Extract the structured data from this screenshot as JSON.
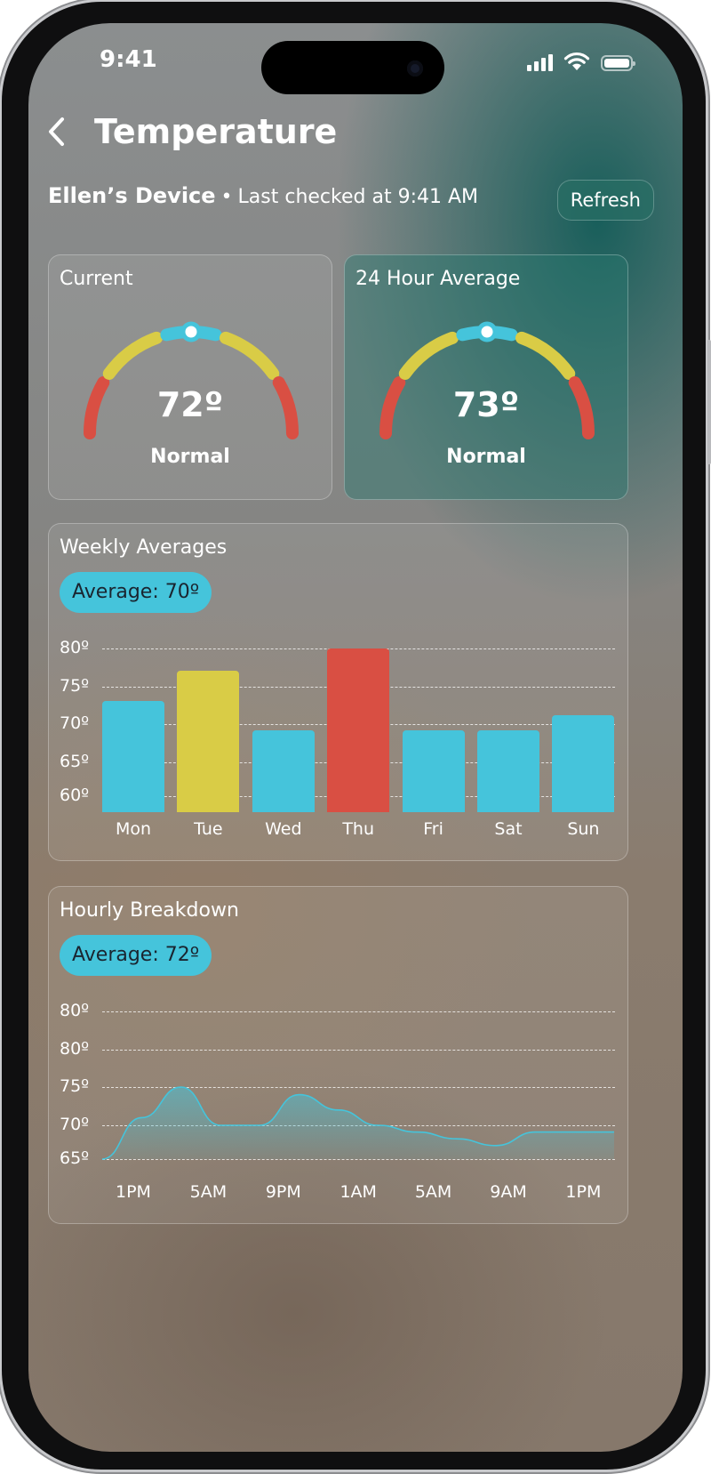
{
  "status_bar": {
    "time": "9:41"
  },
  "header": {
    "title": "Temperature",
    "back_icon": "chevron-left-icon"
  },
  "device": {
    "name": "Ellen’s Device",
    "separator": "•",
    "last_checked": "Last checked at 9:41 AM",
    "refresh_label": "Refresh"
  },
  "gauges": [
    {
      "label": "Current",
      "value": "72º",
      "status": "Normal",
      "level": 0.5
    },
    {
      "label": "24 Hour Average",
      "value": "73º",
      "status": "Normal",
      "level": 0.5
    }
  ],
  "colors": {
    "cool": "#45c4db",
    "warm": "#d9cc46",
    "hot": "#d94f43",
    "accent_teal": "#1a6b64"
  },
  "weekly": {
    "title": "Weekly Averages",
    "average_label": "Average: 70º",
    "y_ticks": [
      "80º",
      "75º",
      "70º",
      "65º",
      "60º"
    ]
  },
  "hourly": {
    "title": "Hourly Breakdown",
    "average_label": "Average: 72º",
    "y_ticks": [
      "80º",
      "80º",
      "75º",
      "70º",
      "65º"
    ],
    "x_ticks": [
      "1PM",
      "5AM",
      "9PM",
      "1AM",
      "5AM",
      "9AM",
      "1PM"
    ]
  },
  "chart_data": [
    {
      "type": "bar",
      "title": "Weekly Averages",
      "categories": [
        "Mon",
        "Tue",
        "Wed",
        "Thu",
        "Fri",
        "Sat",
        "Sun"
      ],
      "values": [
        73,
        77,
        69,
        80,
        69,
        69,
        71
      ],
      "bar_colors": [
        "#45c4db",
        "#d9cc46",
        "#45c4db",
        "#d94f43",
        "#45c4db",
        "#45c4db",
        "#45c4db"
      ],
      "ylim": [
        58,
        80
      ],
      "grid": true
    },
    {
      "type": "area",
      "title": "Hourly Breakdown",
      "x_ticks": [
        "1PM",
        "5AM",
        "9PM",
        "1AM",
        "5AM",
        "9AM",
        "1PM"
      ],
      "x": [
        0,
        0.5,
        1,
        1.5,
        2,
        2.5,
        3,
        3.5,
        4,
        4.5,
        5,
        5.5,
        6,
        6.5
      ],
      "values": [
        65,
        71,
        75,
        70,
        70,
        74,
        72,
        70,
        69,
        68,
        67,
        69,
        69,
        69
      ],
      "color": "#45c4db",
      "ylim": [
        65,
        85
      ],
      "grid": true
    }
  ]
}
